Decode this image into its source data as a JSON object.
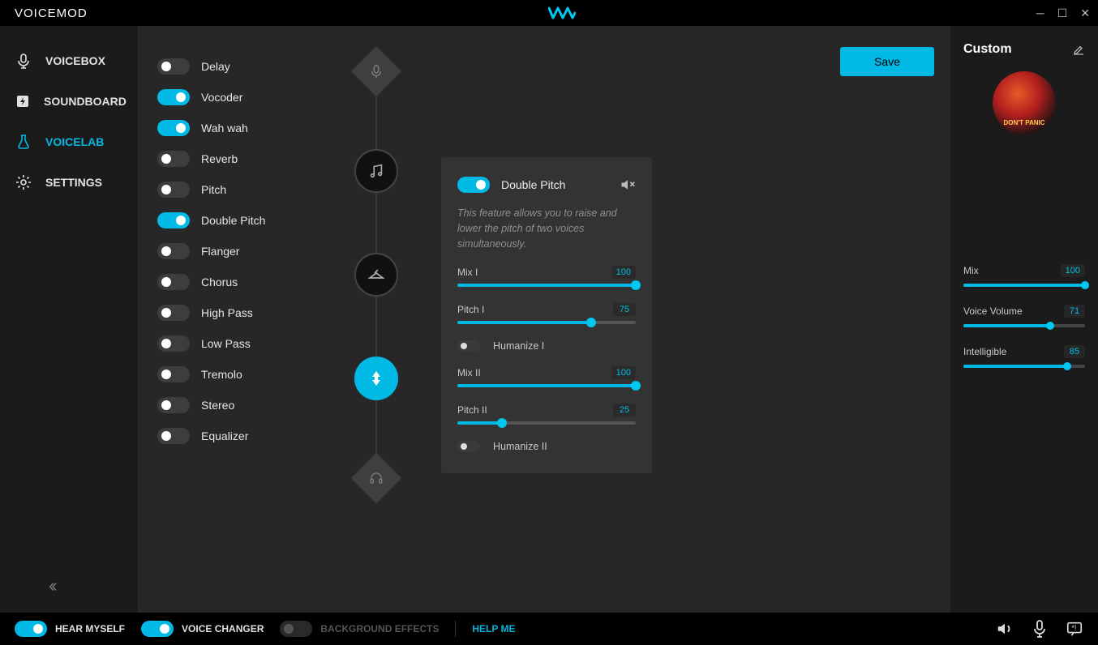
{
  "app": {
    "name": "VOICEMOD"
  },
  "sidebar": {
    "items": [
      {
        "label": "VOICEBOX",
        "icon": "mic"
      },
      {
        "label": "SOUNDBOARD",
        "icon": "bolt"
      },
      {
        "label": "VOICELAB",
        "icon": "flask",
        "active": true
      },
      {
        "label": "SETTINGS",
        "icon": "gear"
      }
    ]
  },
  "save_label": "Save",
  "effects": [
    {
      "label": "Delay",
      "on": false
    },
    {
      "label": "Vocoder",
      "on": true
    },
    {
      "label": "Wah wah",
      "on": true
    },
    {
      "label": "Reverb",
      "on": false
    },
    {
      "label": "Pitch",
      "on": false
    },
    {
      "label": "Double Pitch",
      "on": true
    },
    {
      "label": "Flanger",
      "on": false
    },
    {
      "label": "Chorus",
      "on": false
    },
    {
      "label": "High Pass",
      "on": false
    },
    {
      "label": "Low Pass",
      "on": false
    },
    {
      "label": "Tremolo",
      "on": false
    },
    {
      "label": "Stereo",
      "on": false
    },
    {
      "label": "Equalizer",
      "on": false
    }
  ],
  "detail": {
    "title": "Double Pitch",
    "description": "This feature allows you to raise and lower the pitch of two voices simultaneously.",
    "params": {
      "mix1": {
        "label": "Mix I",
        "value": 100
      },
      "pitch1": {
        "label": "Pitch I",
        "value": 75
      },
      "humanize1": {
        "label": "Humanize I",
        "on": false
      },
      "mix2": {
        "label": "Mix II",
        "value": 100
      },
      "pitch2": {
        "label": "Pitch II",
        "value": 25
      },
      "humanize2": {
        "label": "Humanize II",
        "on": false
      }
    }
  },
  "custom": {
    "title": "Custom",
    "avatar_text": "DON'T PANIC",
    "sliders": {
      "mix": {
        "label": "Mix",
        "value": 100
      },
      "voice_volume": {
        "label": "Voice Volume",
        "value": 71
      },
      "intelligible": {
        "label": "Intelligible",
        "value": 85
      }
    }
  },
  "footer": {
    "hear_myself": {
      "label": "HEAR MYSELF",
      "on": true
    },
    "voice_changer": {
      "label": "VOICE CHANGER",
      "on": true
    },
    "bg_effects": {
      "label": "BACKGROUND EFFECTS",
      "on": false
    },
    "help": "HELP ME"
  }
}
